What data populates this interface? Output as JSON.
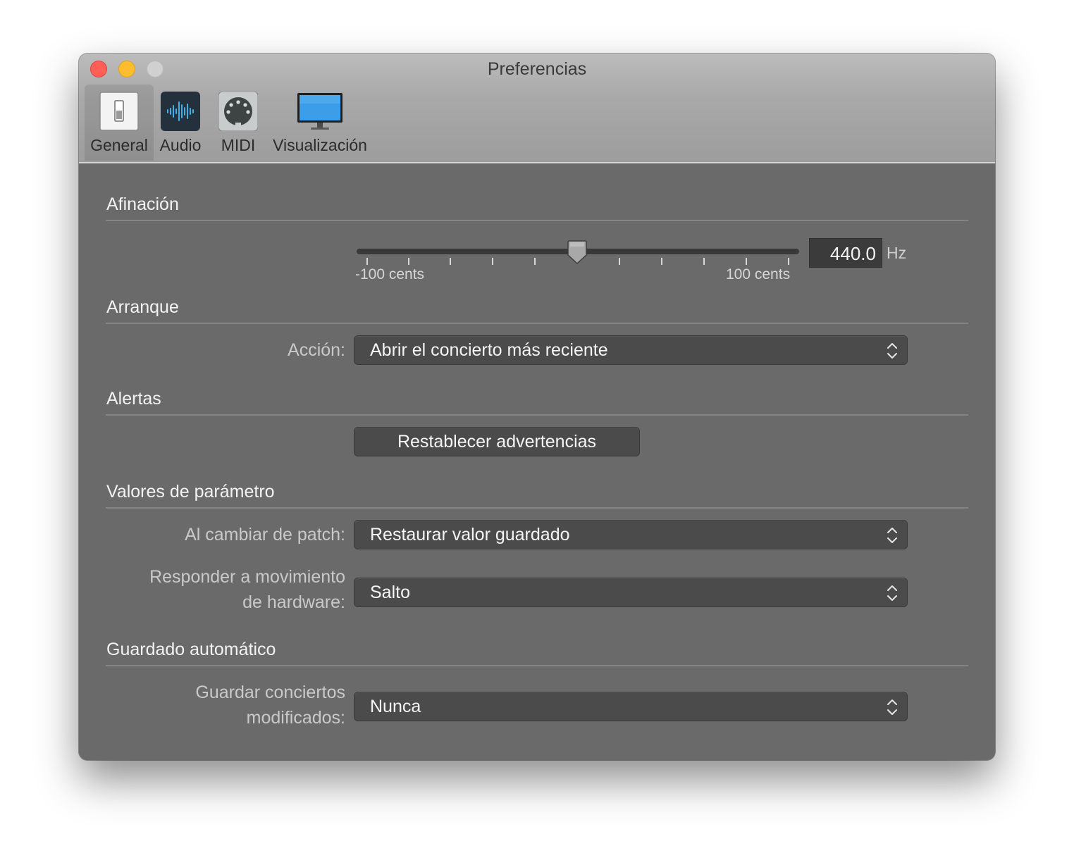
{
  "window": {
    "title": "Preferencias"
  },
  "toolbar": {
    "tabs": [
      {
        "label": "General",
        "icon": "switch-icon",
        "selected": true
      },
      {
        "label": "Audio",
        "icon": "waveform-icon",
        "selected": false
      },
      {
        "label": "MIDI",
        "icon": "midi-connector-icon",
        "selected": false
      },
      {
        "label": "Visualización",
        "icon": "display-icon",
        "selected": false
      }
    ]
  },
  "sections": {
    "tuning": {
      "title": "Afinación",
      "slider_min_label": "-100 cents",
      "slider_max_label": "100 cents",
      "slider_value_cents": 0,
      "frequency_value": "440.0",
      "frequency_unit": "Hz"
    },
    "startup": {
      "title": "Arranque",
      "action_label": "Acción:",
      "action_value": "Abrir el concierto más reciente"
    },
    "alerts": {
      "title": "Alertas",
      "reset_button": "Restablecer advertencias"
    },
    "parameters": {
      "title": "Valores de parámetro",
      "patch_change_label": "Al cambiar de patch:",
      "patch_change_value": "Restaurar valor guardado",
      "hardware_label_line1": "Responder a movimiento",
      "hardware_label_line2": "de hardware:",
      "hardware_value": "Salto"
    },
    "autosave": {
      "title": "Guardado automático",
      "save_label_line1": "Guardar conciertos",
      "save_label_line2": "modificados:",
      "save_value": "Nunca"
    }
  },
  "colors": {
    "window_bg": "#6a6a6a",
    "titlebar_bg": "#a9a9a9",
    "close": "#ff5f57",
    "minimize": "#febc2e",
    "zoom": "#d0d0d0",
    "audio_icon_accent": "#3fb0e8",
    "display_icon_screen": "#3c9ee8"
  }
}
